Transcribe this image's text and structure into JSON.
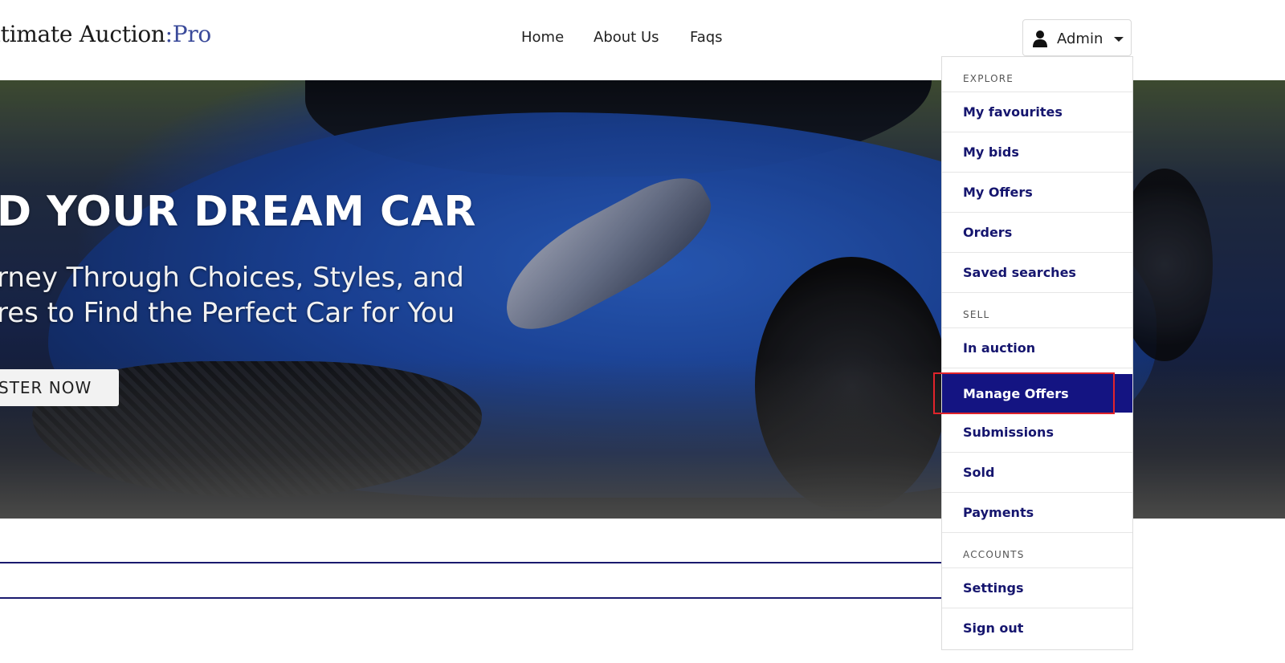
{
  "logo": {
    "main": "ltimate Auction",
    "suffix": ":Pro"
  },
  "nav": {
    "items": [
      "Home",
      "About Us",
      "Faqs"
    ]
  },
  "account": {
    "label": "Admin",
    "user_icon": "user-icon",
    "caret_icon": "chevron-down-icon"
  },
  "hero": {
    "title": "D YOUR DREAM CAR",
    "subtitle_line1": "rney Through Choices, Styles, and",
    "subtitle_line2": "res to Find the Perfect Car for You",
    "cta": "STER NOW"
  },
  "dropdown": {
    "sections": [
      {
        "header": "EXPLORE",
        "items": [
          "My favourites",
          "My bids",
          "My Offers",
          "Orders",
          "Saved searches"
        ]
      },
      {
        "header": "SELL",
        "items": [
          "In auction",
          "Manage Offers",
          "Submissions",
          "Sold",
          "Payments"
        ]
      },
      {
        "header": "ACCOUNTS",
        "items": [
          "Settings",
          "Sign out"
        ]
      }
    ],
    "active_item": "Manage Offers"
  },
  "colors": {
    "accent": "#141482",
    "menu_text": "#15156e",
    "highlight": "#e0242b",
    "logo_suffix": "#3a4a9a"
  }
}
